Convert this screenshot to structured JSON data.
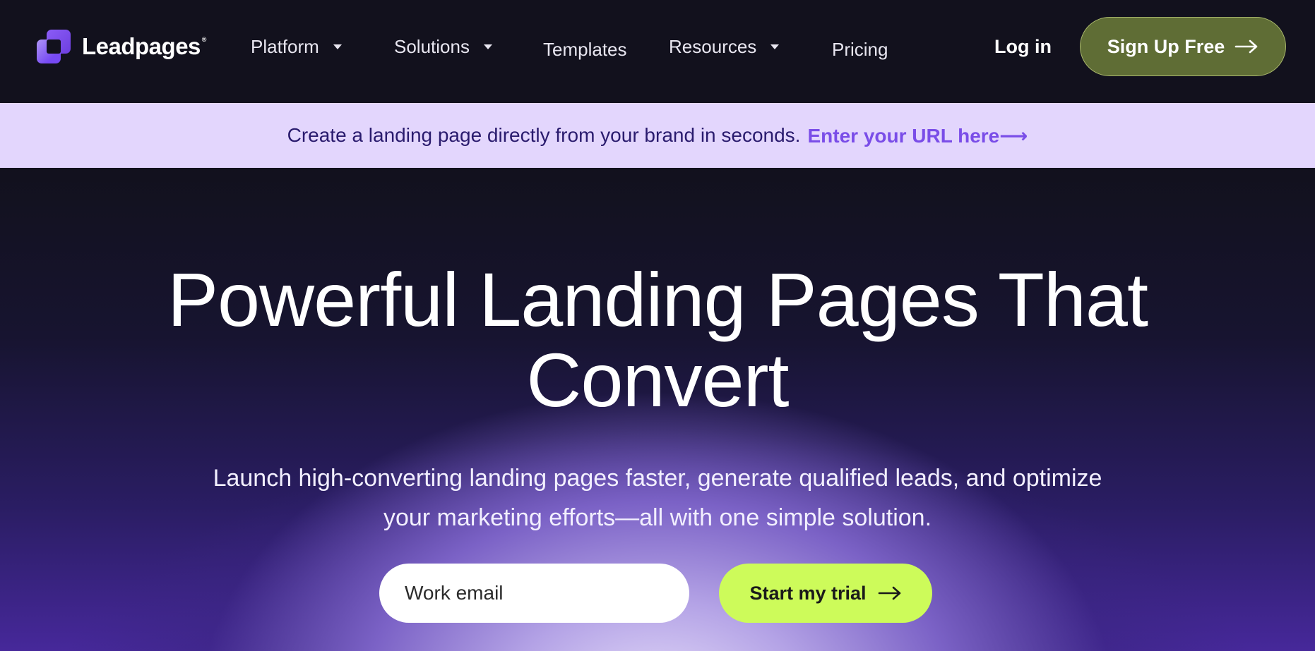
{
  "nav": {
    "logo_text": "Leadpages",
    "logo_mark": "®",
    "items": [
      {
        "label": "Platform",
        "has_dropdown": true
      },
      {
        "label": "Solutions",
        "has_dropdown": true
      },
      {
        "label": "Templates",
        "has_dropdown": false
      },
      {
        "label": "Resources",
        "has_dropdown": true
      },
      {
        "label": "Pricing",
        "has_dropdown": false
      }
    ],
    "login_label": "Log in",
    "signup_label": "Sign Up Free"
  },
  "banner": {
    "text": "Create a landing page directly from your brand in seconds.",
    "link_label": "Enter your URL here⟶"
  },
  "hero": {
    "title_line1": "Powerful Landing Pages That",
    "title_line2": "Convert",
    "subtitle_line1": "Launch high-converting landing pages faster, generate qualified leads, and optimize",
    "subtitle_line2": "your marketing efforts—all with one simple solution.",
    "email_placeholder": "Work email",
    "cta_label": "Start my trial"
  },
  "colors": {
    "nav_bg": "#12111d",
    "banner_bg": "#e3d6fd",
    "banner_link": "#7a4de8",
    "signup_bg": "#5f6d35",
    "cta_bg": "#cdfb5a"
  },
  "icons": {
    "logo": "leadpages-logo-icon",
    "dropdown": "chevron-down-icon",
    "arrow": "arrow-right-icon"
  }
}
